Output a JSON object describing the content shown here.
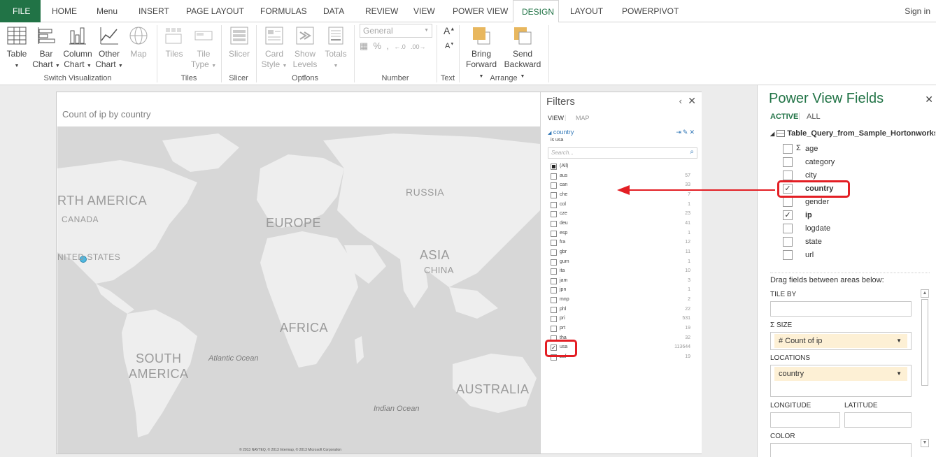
{
  "ribbon_tabs": {
    "file": "FILE",
    "home": "HOME",
    "menu": "Menu",
    "insert": "INSERT",
    "page_layout": "PAGE LAYOUT",
    "formulas": "FORMULAS",
    "data": "DATA",
    "review": "REVIEW",
    "view": "VIEW",
    "power_view": "POWER VIEW",
    "design": "DESIGN",
    "layout": "LAYOUT",
    "powerpivot": "POWERPIVOT"
  },
  "sign_in": "Sign in",
  "ribbon": {
    "table": "Table",
    "bar_chart_1": "Bar",
    "bar_chart_2": "Chart",
    "column_chart_1": "Column",
    "column_chart_2": "Chart",
    "other_chart_1": "Other",
    "other_chart_2": "Chart",
    "map": "Map",
    "tiles": "Tiles",
    "tile_type_1": "Tile",
    "tile_type_2": "Type",
    "slicer": "Slicer",
    "card_style_1": "Card",
    "card_style_2": "Style",
    "show_levels_1": "Show",
    "show_levels_2": "Levels",
    "totals": "Totals",
    "number_format": "General",
    "bring_forward_1": "Bring",
    "bring_forward_2": "Forward",
    "send_backward_1": "Send",
    "send_backward_2": "Backward",
    "groups": {
      "switch_viz": "Switch Visualization",
      "tiles": "Tiles",
      "slicer": "Slicer",
      "options": "Options",
      "number": "Number",
      "text": "Text",
      "arrange": "Arrange"
    }
  },
  "visualization": {
    "title": "Count of ip by country",
    "map_labels": {
      "north_america": "RTH AMERICA",
      "canada": "CANADA",
      "united_states": "NITED STATES",
      "europe": "EUROPE",
      "russia": "RUSSIA",
      "asia": "ASIA",
      "china": "CHINA",
      "africa": "AFRICA",
      "south_america_1": "SOUTH",
      "south_america_2": "AMERICA",
      "australia": "AUSTRALIA"
    },
    "oceans": {
      "atlantic": "Atlantic Ocean",
      "indian": "Indian Ocean"
    },
    "copyright": "© 2013 NAVTEQ, © 2013 Intermap, © 2013 Microsoft Corporation"
  },
  "filters": {
    "title": "Filters",
    "view_tab": "VIEW",
    "map_tab": "MAP",
    "field": "country",
    "condition": "is usa",
    "search_placeholder": "Search...",
    "items": [
      {
        "name": "(All)",
        "count": "",
        "state": "partial"
      },
      {
        "name": "aus",
        "count": "57",
        "state": "off"
      },
      {
        "name": "can",
        "count": "33",
        "state": "off"
      },
      {
        "name": "che",
        "count": "7",
        "state": "off"
      },
      {
        "name": "col",
        "count": "1",
        "state": "off"
      },
      {
        "name": "cze",
        "count": "23",
        "state": "off"
      },
      {
        "name": "deu",
        "count": "41",
        "state": "off"
      },
      {
        "name": "esp",
        "count": "1",
        "state": "off"
      },
      {
        "name": "fra",
        "count": "12",
        "state": "off"
      },
      {
        "name": "gbr",
        "count": "11",
        "state": "off"
      },
      {
        "name": "gum",
        "count": "1",
        "state": "off"
      },
      {
        "name": "ita",
        "count": "10",
        "state": "off"
      },
      {
        "name": "jam",
        "count": "3",
        "state": "off"
      },
      {
        "name": "jpn",
        "count": "1",
        "state": "off"
      },
      {
        "name": "mnp",
        "count": "2",
        "state": "off"
      },
      {
        "name": "phl",
        "count": "22",
        "state": "off"
      },
      {
        "name": "pri",
        "count": "531",
        "state": "off"
      },
      {
        "name": "prt",
        "count": "19",
        "state": "off"
      },
      {
        "name": "tha",
        "count": "32",
        "state": "off"
      },
      {
        "name": "usa",
        "count": "113644",
        "state": "on"
      },
      {
        "name": "zaf",
        "count": "19",
        "state": "off"
      }
    ]
  },
  "fields_panel": {
    "title": "Power View Fields",
    "tab_active": "ACTIVE",
    "tab_all": "ALL",
    "table_name": "Table_Query_from_Sample_Hortonworks",
    "fields": [
      {
        "name": "age",
        "checked": false,
        "sigma": true
      },
      {
        "name": "category",
        "checked": false,
        "sigma": false
      },
      {
        "name": "city",
        "checked": false,
        "sigma": false
      },
      {
        "name": "country",
        "checked": true,
        "sigma": false
      },
      {
        "name": "gender",
        "checked": false,
        "sigma": false
      },
      {
        "name": "ip",
        "checked": true,
        "sigma": false
      },
      {
        "name": "logdate",
        "checked": false,
        "sigma": false
      },
      {
        "name": "state",
        "checked": false,
        "sigma": false
      },
      {
        "name": "url",
        "checked": false,
        "sigma": false
      }
    ],
    "drag_hint": "Drag fields between areas below:",
    "tile_by": "TILE BY",
    "size": "SIZE",
    "size_value": "# Count of ip",
    "locations": "LOCATIONS",
    "locations_value": "country",
    "longitude": "LONGITUDE",
    "latitude": "LATITUDE",
    "color": "COLOR"
  },
  "colors": {
    "accent": "#217346",
    "annotation": "#e31e24",
    "map_point": "#4fb8e0",
    "chip": "#fdf0d5"
  }
}
